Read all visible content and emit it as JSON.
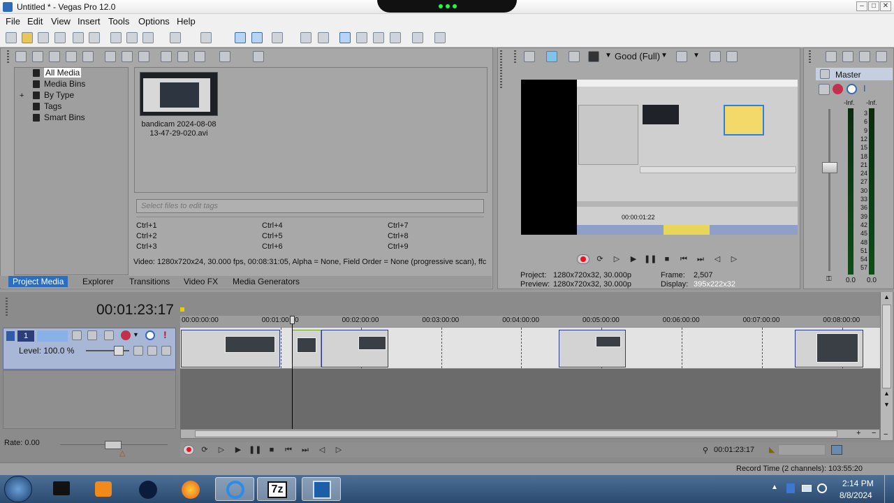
{
  "window": {
    "title": "Untitled * - Vegas Pro 12.0",
    "min": "–",
    "max": "□",
    "close": "✕"
  },
  "menu": [
    "File",
    "Edit",
    "View",
    "Insert",
    "Tools",
    "Options",
    "Help"
  ],
  "project_media": {
    "tree": [
      "All Media",
      "Media Bins",
      "By Type",
      "Tags",
      "Smart Bins"
    ],
    "selected": "All Media",
    "file_label_1": "bandicam 2024-08-08",
    "file_label_2": "13-47-29-020.avi",
    "tags_placeholder": "Select files to edit tags",
    "shortcuts": [
      "Ctrl+1",
      "Ctrl+4",
      "Ctrl+7",
      "Ctrl+2",
      "Ctrl+5",
      "Ctrl+8",
      "Ctrl+3",
      "Ctrl+6",
      "Ctrl+9"
    ],
    "media_info": "Video: 1280x720x24, 30.000 fps, 00:08:31:05, Alpha = None, Field Order = None (progressive scan), ffc"
  },
  "tabs": [
    "Project Media",
    "Explorer",
    "Transitions",
    "Video FX",
    "Media Generators"
  ],
  "preview": {
    "quality": "Good (Full)",
    "project_label": "Project:",
    "project_value": "1280x720x32, 30.000p",
    "preview_label": "Preview:",
    "preview_value": "1280x720x32, 30.000p",
    "frame_label": "Frame:",
    "frame_value": "2,507",
    "display_label": "Display:",
    "display_value": "395x222x32",
    "inner_time": "00:00:01:22"
  },
  "mixer": {
    "title": "Master",
    "inf_left": "-Inf.",
    "inf_right": "-Inf.",
    "scale": [
      "3",
      "6",
      "9",
      "12",
      "15",
      "18",
      "21",
      "24",
      "27",
      "30",
      "33",
      "36",
      "39",
      "42",
      "45",
      "48",
      "51",
      "54",
      "57"
    ],
    "bottom_left": "0.0",
    "bottom_right": "0.0"
  },
  "timeline": {
    "timecode": "00:01:23:17",
    "ruler": [
      "00:00:00:00",
      "00:01:00:00",
      "00:02:00:00",
      "00:03:00:00",
      "00:04:00:00",
      "00:05:00:00",
      "00:06:00:00",
      "00:07:00:00",
      "00:08:00:00"
    ],
    "track_number": "1",
    "level": "Level: 100.0 %",
    "rate": "Rate: 0.00",
    "cursor_time": "00:01:23:17",
    "record_time": "Record Time (2 channels): 103:55:20"
  },
  "taskbar": {
    "time": "2:14 PM",
    "date": "8/8/2024"
  },
  "colors": {
    "accent": "#2d6dc0",
    "track_header": "#a9b7d6",
    "clip_border": "#2b3a8c"
  }
}
